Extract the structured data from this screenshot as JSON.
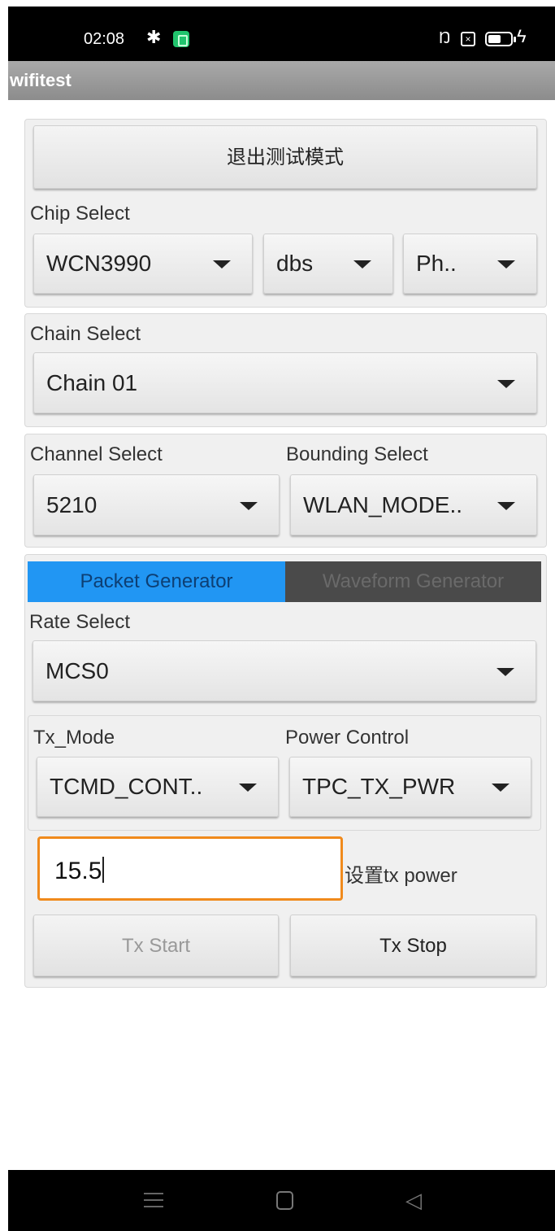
{
  "status_bar": {
    "time": "02:08",
    "icons": [
      "gear-icon",
      "app-notification-icon",
      "nfc-icon",
      "close-box-icon",
      "battery-icon",
      "charging-icon"
    ]
  },
  "app": {
    "title": "wifitest"
  },
  "exit_test_mode_button": "退出测试模式",
  "chip_select": {
    "label": "Chip Select",
    "chip": "WCN3990",
    "mode": "dbs",
    "phy": "Ph.."
  },
  "chain_select": {
    "label": "Chain Select",
    "value": "Chain 01"
  },
  "channel_select": {
    "label": "Channel Select",
    "value": "5210"
  },
  "bounding_select": {
    "label": "Bounding Select",
    "value": "WLAN_MODE.."
  },
  "tabs": [
    {
      "label": "Packet Generator",
      "active": true
    },
    {
      "label": "Waveform Generator",
      "active": false
    }
  ],
  "rate_select": {
    "label": "Rate Select",
    "value": "MCS0"
  },
  "tx_mode": {
    "label": "Tx_Mode",
    "value": "TCMD_CONT.."
  },
  "power_control": {
    "label": "Power Control",
    "value": "TPC_TX_PWR"
  },
  "tx_power": {
    "value": "15.5",
    "set_label": "设置tx power"
  },
  "actions": {
    "tx_start": "Tx Start",
    "tx_stop": "Tx Stop"
  },
  "colors": {
    "active_tab": "#2196f3",
    "inactive_tab": "#4a4a4a",
    "input_focus_border": "#f08a1c",
    "title_bar": "#9a9a9a"
  },
  "nav_bar": {
    "icons": [
      "menu-icon",
      "home-icon",
      "back-icon"
    ]
  }
}
